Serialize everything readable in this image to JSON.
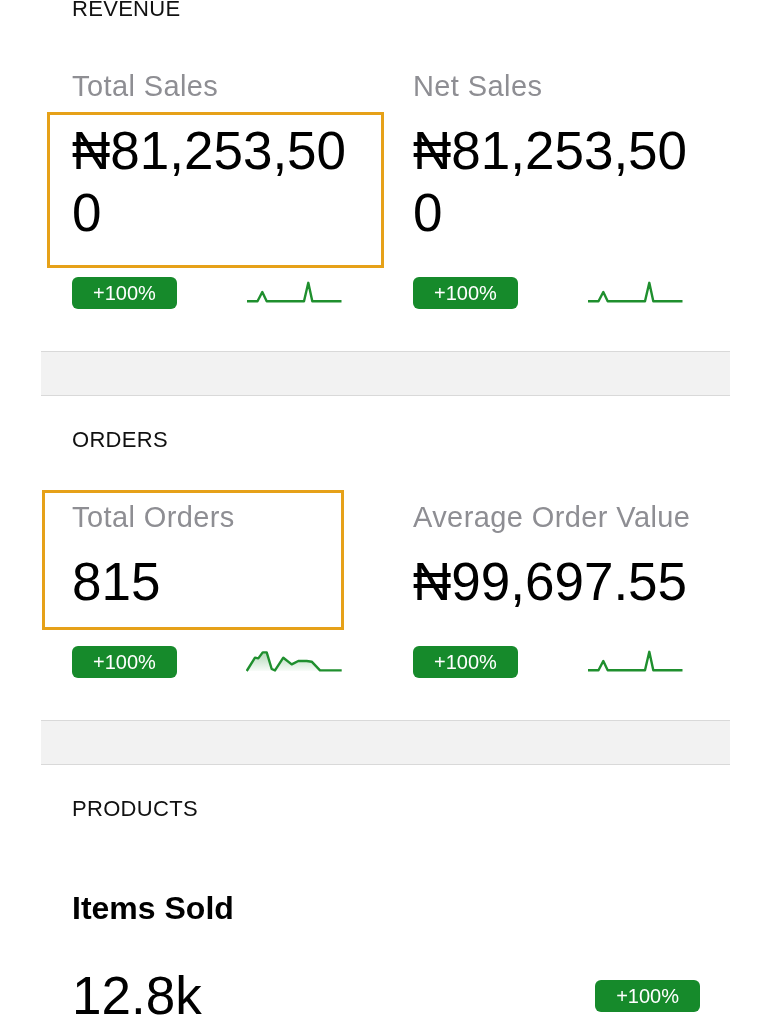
{
  "sections": [
    {
      "title": "REVENUE",
      "metrics": [
        {
          "kind": "tile",
          "label": "Total Sales",
          "value": "₦81,253,500",
          "change": "+100%",
          "highlight": {
            "label": false,
            "value": true
          },
          "sparkline": {
            "kind": "spike"
          }
        },
        {
          "kind": "tile",
          "label": "Net Sales",
          "value": "₦81,253,500",
          "change": "+100%",
          "highlight": {
            "label": false,
            "value": false
          },
          "sparkline": {
            "kind": "spike"
          }
        }
      ]
    },
    {
      "title": "ORDERS",
      "metrics": [
        {
          "kind": "tile",
          "label": "Total Orders",
          "value": "815",
          "change": "+100%",
          "highlight": {
            "label": true,
            "value": true
          },
          "sparkline": {
            "kind": "area"
          }
        },
        {
          "kind": "tile",
          "label": "Average Order Value",
          "value": "₦99,697.55",
          "change": "+100%",
          "highlight": {
            "label": false,
            "value": false
          },
          "sparkline": {
            "kind": "spike"
          }
        }
      ]
    },
    {
      "title": "PRODUCTS",
      "metrics": [
        {
          "kind": "wide",
          "label": "Items Sold",
          "value": "12.8k",
          "change": "+100%",
          "highlight": {
            "label": false,
            "value": false
          }
        }
      ]
    }
  ]
}
